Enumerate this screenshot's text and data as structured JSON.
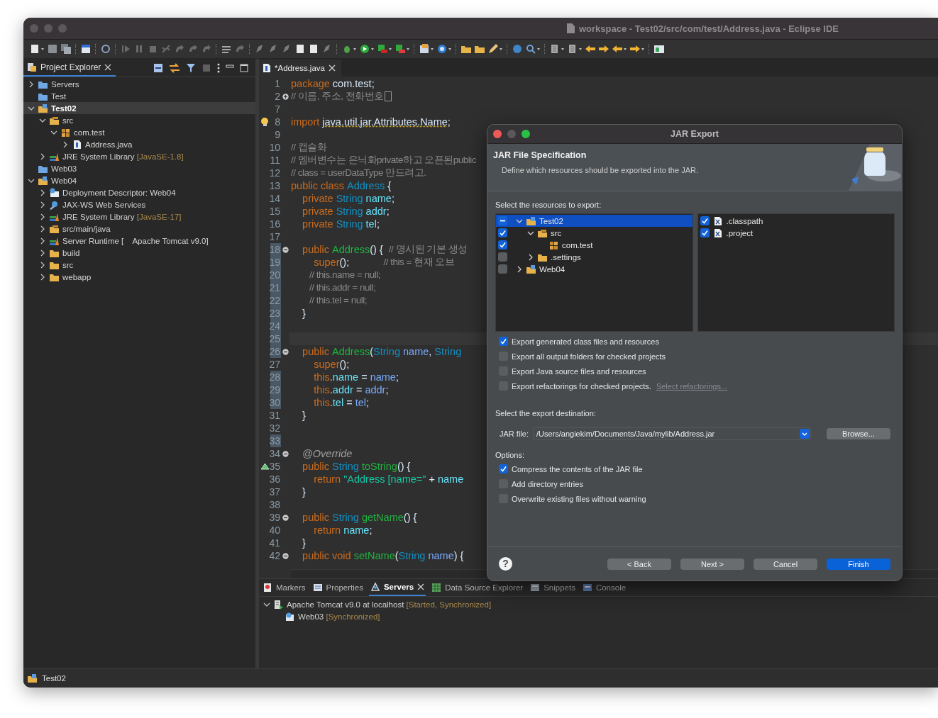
{
  "window": {
    "title": "workspace - Test02/src/com/test/Address.java - Eclipse IDE"
  },
  "project_explorer": {
    "tab": "Project Explorer",
    "tree": [
      {
        "label": "Servers",
        "kind": "folder-blue-open",
        "expanded": false,
        "selected": false
      },
      {
        "label": "Test",
        "kind": "folder-blue",
        "selected": false
      },
      {
        "label": "Test02",
        "kind": "project",
        "expanded": true,
        "selected": true,
        "children": [
          {
            "label": "src",
            "kind": "source-folder",
            "expanded": true,
            "selected": false,
            "children": [
              {
                "label": "com.test",
                "kind": "package",
                "expanded": true,
                "selected": false,
                "children": [
                  {
                    "label": "Address.java",
                    "kind": "java-file",
                    "expanded": false,
                    "selected": false
                  }
                ]
              }
            ]
          },
          {
            "label": "JRE System Library ",
            "suffix": "[JavaSE-1.8]",
            "kind": "library",
            "expanded": false,
            "selected": false
          }
        ]
      },
      {
        "label": "Web03",
        "kind": "folder-blue",
        "selected": false
      },
      {
        "label": "Web04",
        "kind": "web-project",
        "expanded": true,
        "selected": false,
        "children": [
          {
            "label": "Deployment Descriptor: Web04",
            "kind": "descriptor",
            "expanded": false,
            "selected": false
          },
          {
            "label": "JAX-WS Web Services",
            "kind": "web-services",
            "expanded": false,
            "selected": false
          },
          {
            "label": "JRE System Library ",
            "suffix": "[JavaSE-17]",
            "kind": "library",
            "expanded": false,
            "selected": false
          },
          {
            "label": "src/main/java",
            "kind": "source-folder",
            "expanded": false,
            "selected": false
          },
          {
            "label": "Server Runtime [    Apache Tomcat v9.0]",
            "kind": "library",
            "expanded": false,
            "selected": false
          },
          {
            "label": "build",
            "kind": "folder",
            "expanded": false,
            "selected": false
          },
          {
            "label": "src",
            "kind": "folder",
            "expanded": false,
            "selected": false
          },
          {
            "label": "webapp",
            "kind": "folder",
            "expanded": false,
            "selected": false
          }
        ]
      }
    ]
  },
  "editor": {
    "tab": "*Address.java",
    "lines": [
      {
        "number": "1",
        "marked": false,
        "tokens": [
          {
            "kind": "keyword",
            "text": "package "
          },
          {
            "kind": "plain",
            "text": "com.test;"
          }
        ]
      },
      {
        "number": "2",
        "marked": false,
        "fold_open": false,
        "folded": true,
        "tokens": [
          {
            "kind": "comment",
            "text": "// 이름, 주소, 전화번호"
          }
        ]
      },
      {
        "number": "7",
        "marked": false
      },
      {
        "number": "8",
        "marked": false,
        "warning": true,
        "tokens": [
          {
            "kind": "keyword",
            "text": "import "
          },
          {
            "kind": "warning",
            "text": "java.util.jar.Attributes.Name"
          },
          {
            "kind": "plain",
            "text": ";"
          }
        ]
      },
      {
        "number": "9",
        "marked": false
      },
      {
        "number": "10",
        "marked": false,
        "tokens": [
          {
            "kind": "comment",
            "text": "// 캡슐화"
          }
        ]
      },
      {
        "number": "11",
        "marked": false,
        "tokens": [
          {
            "kind": "comment",
            "text": "// 멤버변수는 은닉화private하고 오픈된public"
          }
        ]
      },
      {
        "number": "12",
        "marked": false,
        "tokens": [
          {
            "kind": "comment",
            "text": "// class = userDataType 만드려고."
          }
        ]
      },
      {
        "number": "13",
        "marked": false,
        "tokens": [
          {
            "kind": "keyword",
            "text": "public class "
          },
          {
            "kind": "type",
            "text": "Address"
          },
          {
            "kind": "plain",
            "text": " {"
          }
        ]
      },
      {
        "number": "14",
        "marked": false,
        "tokens": [
          {
            "kind": "keyword",
            "text": "    private "
          },
          {
            "kind": "type",
            "text": "String "
          },
          {
            "kind": "field",
            "text": "name"
          },
          {
            "kind": "plain",
            "text": ";"
          }
        ]
      },
      {
        "number": "15",
        "marked": false,
        "tokens": [
          {
            "kind": "keyword",
            "text": "    private "
          },
          {
            "kind": "type",
            "text": "String "
          },
          {
            "kind": "field",
            "text": "addr"
          },
          {
            "kind": "plain",
            "text": ";"
          }
        ]
      },
      {
        "number": "16",
        "marked": false,
        "tokens": [
          {
            "kind": "keyword",
            "text": "    private "
          },
          {
            "kind": "type",
            "text": "String "
          },
          {
            "kind": "field",
            "text": "tel"
          },
          {
            "kind": "plain",
            "text": ";"
          }
        ]
      },
      {
        "number": "17",
        "marked": false
      },
      {
        "number": "18",
        "marked": true,
        "fold_open": true,
        "tokens": [
          {
            "kind": "keyword",
            "text": "    public "
          },
          {
            "kind": "method",
            "text": "Address"
          },
          {
            "kind": "plain",
            "text": "() {  "
          },
          {
            "kind": "comment",
            "text": "// 명시된 기본 생성"
          }
        ]
      },
      {
        "number": "19",
        "marked": true,
        "tokens": [
          {
            "kind": "keyword",
            "text": "        super"
          },
          {
            "kind": "plain",
            "text": "();            "
          },
          {
            "kind": "comment",
            "text": "// this = 현재 오브"
          }
        ]
      },
      {
        "number": "20",
        "marked": true,
        "tokens": [
          {
            "kind": "comment",
            "text": "        // this.name = null;"
          }
        ]
      },
      {
        "number": "21",
        "marked": true,
        "tokens": [
          {
            "kind": "comment",
            "text": "        // this.addr = null;"
          }
        ]
      },
      {
        "number": "22",
        "marked": true,
        "tokens": [
          {
            "kind": "comment",
            "text": "        // this.tel = null;"
          }
        ]
      },
      {
        "number": "23",
        "marked": true,
        "tokens": [
          {
            "kind": "plain",
            "text": "    }"
          }
        ]
      },
      {
        "number": "24",
        "marked": true
      },
      {
        "number": "25",
        "marked": true,
        "current": true
      },
      {
        "number": "26",
        "marked": true,
        "fold_open": true,
        "tokens": [
          {
            "kind": "keyword",
            "text": "    public "
          },
          {
            "kind": "method",
            "text": "Address"
          },
          {
            "kind": "plain",
            "text": "("
          },
          {
            "kind": "type",
            "text": "String "
          },
          {
            "kind": "param",
            "text": "name"
          },
          {
            "kind": "plain",
            "text": ", "
          },
          {
            "kind": "type",
            "text": "String"
          }
        ]
      },
      {
        "number": "27",
        "marked": false,
        "tokens": [
          {
            "kind": "keyword",
            "text": "        super"
          },
          {
            "kind": "plain",
            "text": "();"
          }
        ]
      },
      {
        "number": "28",
        "marked": true,
        "tokens": [
          {
            "kind": "keyword",
            "text": "        this"
          },
          {
            "kind": "plain",
            "text": "."
          },
          {
            "kind": "field",
            "text": "name"
          },
          {
            "kind": "plain",
            "text": " = "
          },
          {
            "kind": "param",
            "text": "name"
          },
          {
            "kind": "plain",
            "text": ";"
          }
        ]
      },
      {
        "number": "29",
        "marked": true,
        "tokens": [
          {
            "kind": "keyword",
            "text": "        this"
          },
          {
            "kind": "plain",
            "text": "."
          },
          {
            "kind": "field",
            "text": "addr"
          },
          {
            "kind": "plain",
            "text": " = "
          },
          {
            "kind": "param",
            "text": "addr"
          },
          {
            "kind": "plain",
            "text": ";"
          }
        ]
      },
      {
        "number": "30",
        "marked": true,
        "tokens": [
          {
            "kind": "keyword",
            "text": "        this"
          },
          {
            "kind": "plain",
            "text": "."
          },
          {
            "kind": "field",
            "text": "tel"
          },
          {
            "kind": "plain",
            "text": " = "
          },
          {
            "kind": "param",
            "text": "tel"
          },
          {
            "kind": "plain",
            "text": ";"
          }
        ]
      },
      {
        "number": "31",
        "marked": false,
        "tokens": [
          {
            "kind": "plain",
            "text": "    }"
          }
        ]
      },
      {
        "number": "32",
        "marked": false
      },
      {
        "number": "33",
        "marked": true
      },
      {
        "number": "34",
        "marked": false,
        "fold_open": true,
        "tokens": [
          {
            "kind": "annotation",
            "text": "    @Override"
          }
        ]
      },
      {
        "number": "35",
        "marked": false,
        "override": true,
        "tokens": [
          {
            "kind": "keyword",
            "text": "    public "
          },
          {
            "kind": "type",
            "text": "String "
          },
          {
            "kind": "method",
            "text": "toString"
          },
          {
            "kind": "plain",
            "text": "() {"
          }
        ]
      },
      {
        "number": "36",
        "marked": false,
        "tokens": [
          {
            "kind": "keyword",
            "text": "        return "
          },
          {
            "kind": "string",
            "text": "\"Address [name=\""
          },
          {
            "kind": "plain",
            "text": " + "
          },
          {
            "kind": "field",
            "text": "name"
          }
        ]
      },
      {
        "number": "37",
        "marked": false,
        "tokens": [
          {
            "kind": "plain",
            "text": "    }"
          }
        ]
      },
      {
        "number": "38",
        "marked": false
      },
      {
        "number": "39",
        "marked": false,
        "fold_open": true,
        "tokens": [
          {
            "kind": "keyword",
            "text": "    public "
          },
          {
            "kind": "type",
            "text": "String "
          },
          {
            "kind": "method",
            "text": "getName"
          },
          {
            "kind": "plain",
            "text": "() {"
          }
        ]
      },
      {
        "number": "40",
        "marked": false,
        "tokens": [
          {
            "kind": "keyword",
            "text": "        return "
          },
          {
            "kind": "field",
            "text": "name"
          },
          {
            "kind": "plain",
            "text": ";"
          }
        ]
      },
      {
        "number": "41",
        "marked": false,
        "tokens": [
          {
            "kind": "plain",
            "text": "    }"
          }
        ]
      },
      {
        "number": "42",
        "marked": false,
        "fold_open": true,
        "tokens": [
          {
            "kind": "keyword",
            "text": "    public void "
          },
          {
            "kind": "method",
            "text": "setName"
          },
          {
            "kind": "plain",
            "text": "("
          },
          {
            "kind": "type",
            "text": "String "
          },
          {
            "kind": "param",
            "text": "name"
          },
          {
            "kind": "plain",
            "text": ") {"
          }
        ]
      }
    ]
  },
  "bottom_panel": {
    "tabs": [
      {
        "label": "Markers",
        "kind": "markers",
        "selected": false
      },
      {
        "label": "Properties",
        "kind": "properties",
        "selected": false
      },
      {
        "label": "Servers",
        "kind": "servers",
        "selected": true
      },
      {
        "label": "Data Source Explorer",
        "kind": "database",
        "selected": false
      },
      {
        "label": "Snippets",
        "kind": "snippets",
        "selected": false
      },
      {
        "label": "Console",
        "kind": "console",
        "selected": false
      }
    ],
    "tree": [
      {
        "label": "Apache Tomcat v9.0 at localhost",
        "suffix": "[Started, Synchronized]",
        "kind": "server",
        "expanded": true,
        "selected": false,
        "children": [
          {
            "label": "Web03",
            "suffix": "[Synchronized]",
            "kind": "module",
            "selected": false
          }
        ]
      }
    ]
  },
  "status_bar": {
    "text": "Test02"
  },
  "dialog": {
    "title": "JAR Export",
    "heading": "JAR File Specification",
    "description": "Define which resources should be exported into the JAR.",
    "resources_label": "Select the resources to export:",
    "resource_tree": [
      {
        "label": "Test02",
        "kind": "project",
        "checked": true,
        "partial": true,
        "expanded": true,
        "selected": true,
        "children": [
          {
            "label": "src",
            "kind": "source-folder",
            "checked": true,
            "expanded": true,
            "selected": false,
            "children": [
              {
                "label": "com.test",
                "kind": "package",
                "checked": true,
                "selected": false
              }
            ]
          },
          {
            "label": ".settings",
            "kind": "folder",
            "checked": false,
            "expanded": false,
            "selected": false
          }
        ]
      },
      {
        "label": "Web04",
        "kind": "project",
        "checked": false,
        "expanded": false,
        "selected": false
      }
    ],
    "resource_files": [
      {
        "label": ".classpath",
        "checked": true
      },
      {
        "label": ".project",
        "checked": true
      }
    ],
    "export_options": [
      {
        "label": "Export generated class files and resources",
        "checked": true
      },
      {
        "label": "Export all output folders for checked projects",
        "checked": false
      },
      {
        "label": "Export Java source files and resources",
        "checked": false
      },
      {
        "label": "Export refactorings for checked projects.",
        "checked": false,
        "link": "Select refactorings...",
        "link_disabled": true
      }
    ],
    "destination_label": "Select the export destination:",
    "jar_file": {
      "label": "JAR file:",
      "value": "/Users/angiekim/Documents/Java/mylib/Address.jar"
    },
    "browse": "Browse...",
    "options_label": "Options:",
    "options": [
      {
        "label": "Compress the contents of the JAR file",
        "checked": true
      },
      {
        "label": "Add directory entries",
        "checked": false
      },
      {
        "label": "Overwrite existing files without warning",
        "checked": false
      }
    ],
    "help": "?",
    "buttons": [
      {
        "label": "< Back",
        "default": false
      },
      {
        "label": "Next >",
        "default": false
      },
      {
        "label": "Cancel",
        "default": false
      },
      {
        "label": "Finish",
        "default": true
      }
    ]
  }
}
